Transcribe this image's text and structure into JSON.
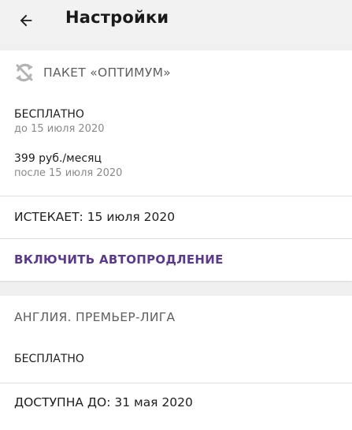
{
  "header": {
    "title": "Настройки",
    "back_icon": "arrow-left-icon"
  },
  "package": {
    "icon": "no-autorenew-icon",
    "title": "ПАКЕТ «ОПТИМУМ»",
    "prices": [
      {
        "label": "БЕСПЛАТНО",
        "note": "до 15 июля 2020"
      },
      {
        "label": "399 руб./месяц",
        "note": "после 15 июля 2020"
      }
    ],
    "expires": "ИСТЕКАЕТ: 15 июля 2020",
    "action_label": "ВКЛЮЧИТЬ АВТОПРОДЛЕНИЕ"
  },
  "league": {
    "title": "АНГЛИЯ. ПРЕМЬЕР-ЛИГА",
    "price": "БЕСПЛАТНО",
    "available": "ДОСТУПНА ДО: 31 мая 2020"
  },
  "colors": {
    "background": "#f0f0f0",
    "card": "#ffffff",
    "accent": "#5b3a8e",
    "muted": "#8a8a8a"
  }
}
